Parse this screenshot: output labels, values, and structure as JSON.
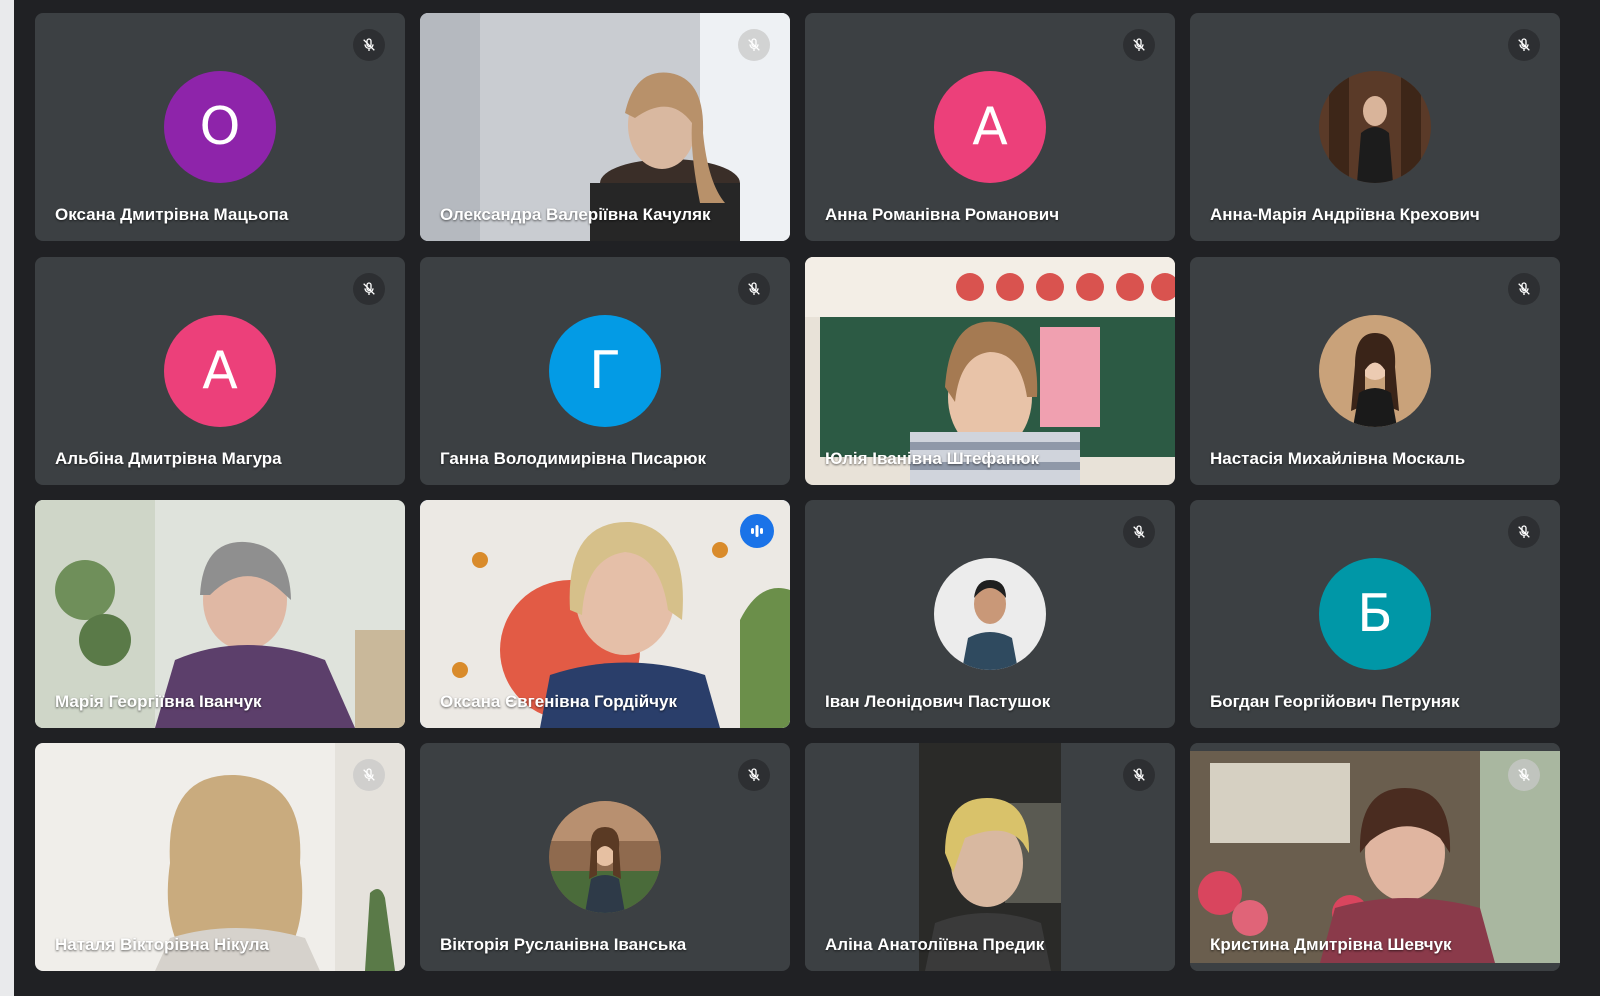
{
  "participants": [
    {
      "name": "Оксана Дмитрівна Мацьопа",
      "avatar_letter": "О",
      "avatar_color": "#8e24aa",
      "muted": true
    },
    {
      "name": "Олександра Валеріївна Качуляк",
      "video": true,
      "muted": true
    },
    {
      "name": "Анна Романівна Романович",
      "avatar_letter": "А",
      "avatar_color": "#ec407a",
      "muted": true
    },
    {
      "name": "Анна-Марія Андріївна Крехович",
      "profile_photo": true,
      "muted": true
    },
    {
      "name": "Альбіна Дмитрівна Магура",
      "avatar_letter": "А",
      "avatar_color": "#ec407a",
      "muted": true
    },
    {
      "name": "Ганна Володимирівна Писарюк",
      "avatar_letter": "Г",
      "avatar_color": "#039be5",
      "muted": true
    },
    {
      "name": "Юлія Іванівна Штефанюк",
      "video": true,
      "muted": false
    },
    {
      "name": "Настасія Михайлівна Москаль",
      "profile_photo": true,
      "muted": true
    },
    {
      "name": "Марія Георгіївна Іванчук",
      "video": true,
      "muted": false
    },
    {
      "name": "Оксана Євгенівна Гордійчук",
      "video": true,
      "muted": false,
      "speaking": true
    },
    {
      "name": "Іван Леонідович Пастушок",
      "profile_photo": true,
      "muted": true
    },
    {
      "name": "Богдан Георгійович Петруняк",
      "avatar_letter": "Б",
      "avatar_color": "#0097a7",
      "muted": true
    },
    {
      "name": "Наталя Вікторівна Нікула",
      "video": true,
      "muted": true
    },
    {
      "name": "Вікторія Русланівна Іванська",
      "profile_photo": true,
      "muted": true
    },
    {
      "name": "Аліна Анатоліївна Предик",
      "video": true,
      "muted": true
    },
    {
      "name": "Кристина Дмитрівна Шевчук",
      "video": true,
      "muted": true
    }
  ],
  "colors": {
    "background": "#202124",
    "tile": "#3c4043",
    "speaking_border": "#8ab4f8",
    "speaking_badge": "#1a73e8"
  },
  "icons": {
    "muted": "mic-off-icon",
    "speaking": "audio-level-icon"
  }
}
